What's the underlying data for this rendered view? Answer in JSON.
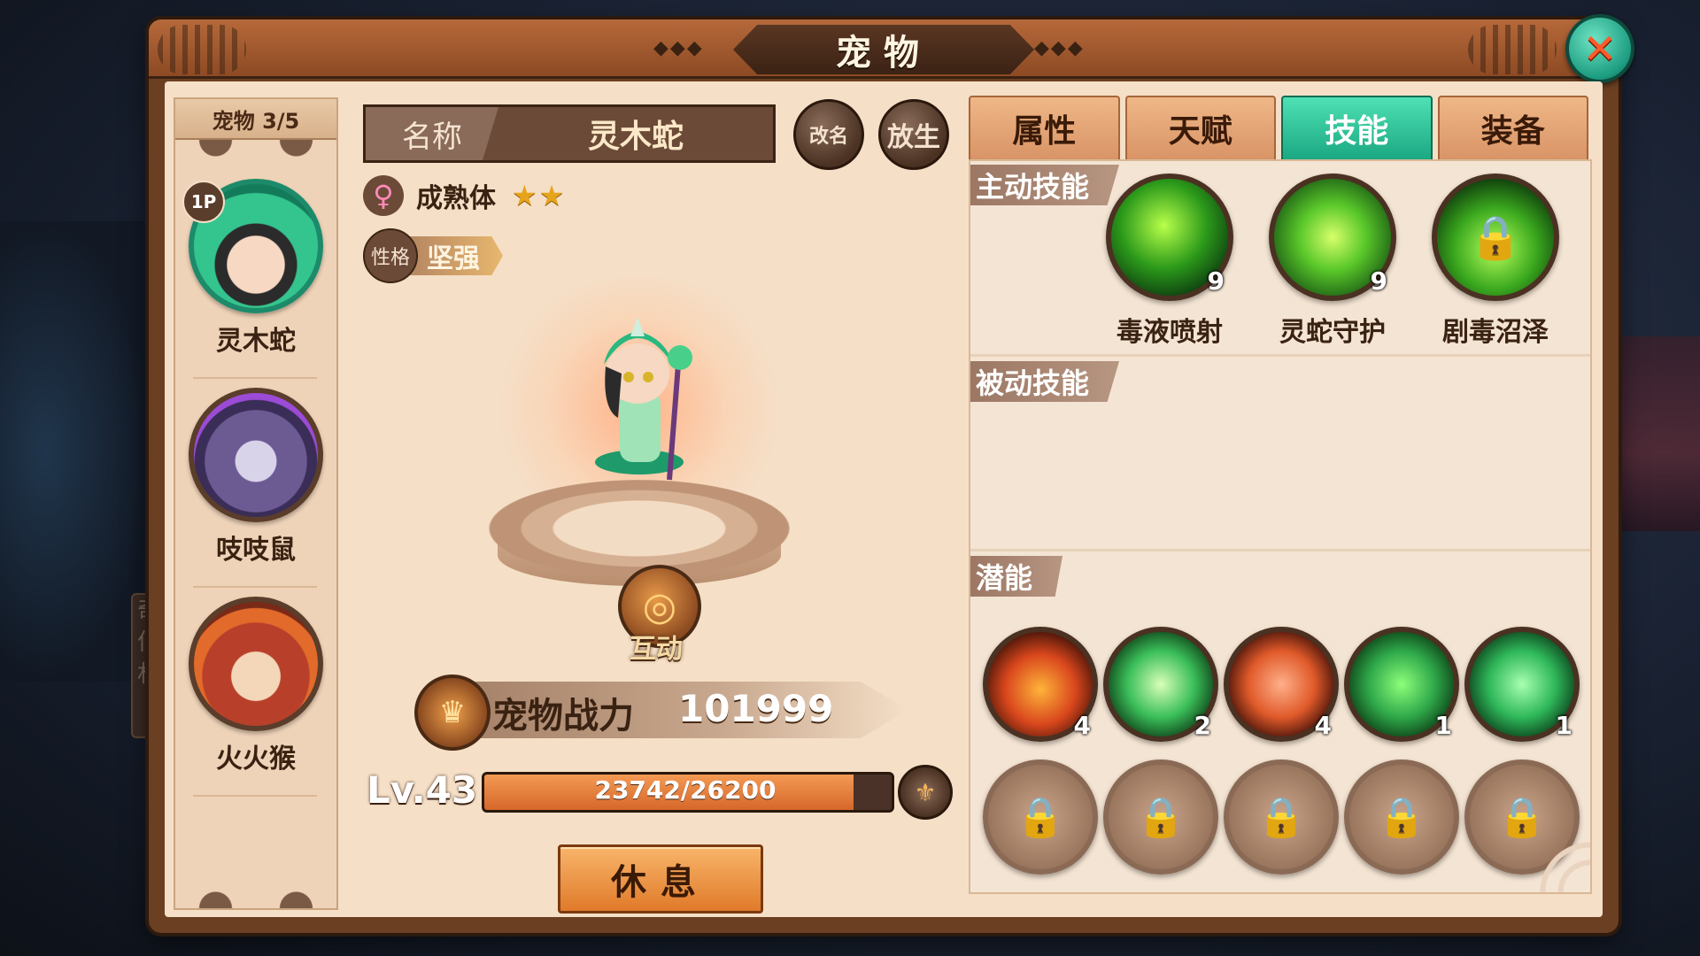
{
  "window": {
    "title": "宠物"
  },
  "pet_list": {
    "count_label": "宠物 3/5",
    "pets": [
      {
        "name": "灵木蛇",
        "badge": "1P",
        "selected": true
      },
      {
        "name": "吱吱鼠",
        "selected": false
      },
      {
        "name": "火火猴",
        "selected": false
      }
    ]
  },
  "pet": {
    "name_label": "名称",
    "name": "灵木蛇",
    "stage": "成熟体",
    "stars": "★★",
    "nature_tag": "性格",
    "nature": "坚强",
    "rename_label": "改名",
    "release_label": "放生",
    "interact_label": "互动",
    "power_label": "宠物战力",
    "power_value": "101999",
    "level": "Lv.43",
    "exp_text": "23742/26200",
    "exp_fraction": 0.906,
    "rest_label": "休息"
  },
  "tabs": [
    {
      "label": "属性",
      "active": false
    },
    {
      "label": "天赋",
      "active": false
    },
    {
      "label": "技能",
      "active": true
    },
    {
      "label": "装备",
      "active": false
    }
  ],
  "skills": {
    "active_title": "主动技能",
    "active": [
      {
        "name": "毒液喷射",
        "level": "9",
        "icon": "poison-spray-icon",
        "locked": false
      },
      {
        "name": "灵蛇守护",
        "level": "9",
        "icon": "snake-guard-icon",
        "locked": false
      },
      {
        "name": "剧毒沼泽",
        "level": "",
        "icon": "lock-icon",
        "locked": true
      }
    ],
    "passive_title": "被动技能",
    "potential_title": "潜能",
    "potentials": [
      {
        "level": "4",
        "icon": "fire-beast-icon",
        "color": "#d9471d"
      },
      {
        "level": "2",
        "icon": "wind-dash-icon",
        "color": "#3bbf5a"
      },
      {
        "level": "4",
        "icon": "fire-heart-icon",
        "color": "#e05a2a"
      },
      {
        "level": "1",
        "icon": "green-shield-icon",
        "color": "#2fa84a"
      },
      {
        "level": "1",
        "icon": "green-heart-icon",
        "color": "#2fb85a"
      }
    ],
    "locked_potential_count": 5
  },
  "colors": {
    "accent": "#1aa882",
    "panel": "#f5dfc7",
    "frame": "#6b3f22"
  }
}
